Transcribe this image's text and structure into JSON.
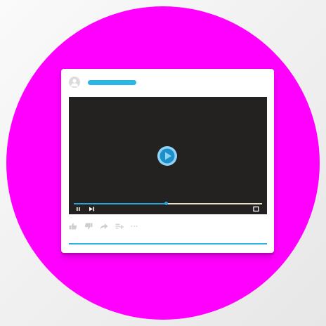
{
  "colors": {
    "background": "#f2f2f2",
    "circle": "#ff00ff",
    "card": "#ffffff",
    "accent": "#29b6e3",
    "player_background": "#242121",
    "play_button": "#8fd3f4",
    "progress_fill": "#2aa5d8",
    "progress_track": "#e8e0c8",
    "icon_gray": "#cfcfcf"
  },
  "post": {
    "avatar_icon": "user-icon",
    "title_placeholder": "blue-bar"
  },
  "player": {
    "center_icon": "play-icon",
    "progress_fraction": 0.49,
    "controls": [
      "pause-icon",
      "skip-next-icon",
      "fullscreen-icon"
    ]
  },
  "actions": [
    "thumbs-up-icon",
    "thumbs-down-icon",
    "share-icon",
    "playlist-add-icon",
    "more-icon"
  ]
}
